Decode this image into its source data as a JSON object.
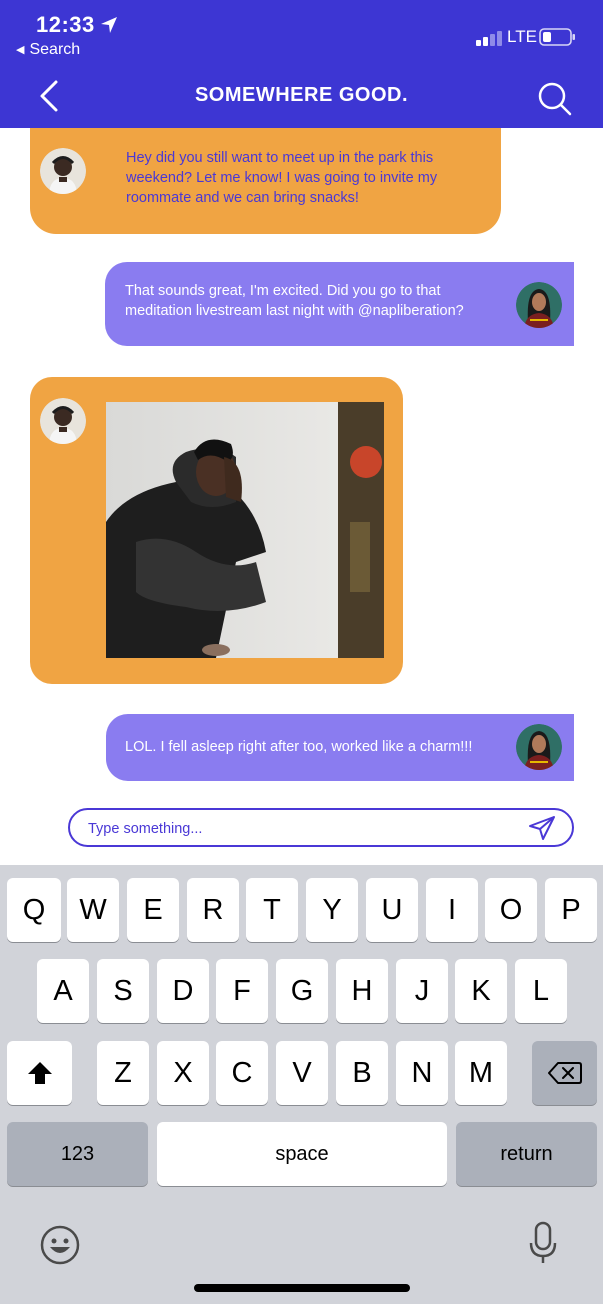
{
  "status_bar": {
    "time": "12:33",
    "back_app": "Search",
    "network": "LTE"
  },
  "header": {
    "title": "SOMEWHERE GOOD.",
    "color": "#3d36d3"
  },
  "messages": [
    {
      "side": "incoming",
      "text": "Hey did you still want to meet up in the park this weekend? Let me know! I was going to invite my roommate and we can bring snacks!"
    },
    {
      "side": "outgoing",
      "text": "That sounds great, I'm excited. Did you go to that meditation livestream last night with @napliberation?"
    },
    {
      "side": "incoming",
      "type": "image"
    },
    {
      "side": "outgoing",
      "text": "LOL. I fell asleep right after too, worked like a charm!!!"
    }
  ],
  "colors": {
    "incoming": "#f0a443",
    "outgoing": "#8a7cf0",
    "accent": "#4a38d6"
  },
  "composer": {
    "placeholder": "Type something...",
    "value": ""
  },
  "keyboard": {
    "row1": [
      "Q",
      "W",
      "E",
      "R",
      "T",
      "Y",
      "U",
      "I",
      "O",
      "P"
    ],
    "row2": [
      "A",
      "S",
      "D",
      "F",
      "G",
      "H",
      "J",
      "K",
      "L"
    ],
    "row3": [
      "Z",
      "X",
      "C",
      "V",
      "B",
      "N",
      "M"
    ],
    "numbers": "123",
    "space": "space",
    "return": "return"
  },
  "icons": [
    "location-arrow-icon",
    "signal-icon",
    "battery-icon",
    "back-icon",
    "search-icon",
    "send-icon",
    "shift-icon",
    "delete-icon",
    "emoji-icon",
    "microphone-icon"
  ]
}
